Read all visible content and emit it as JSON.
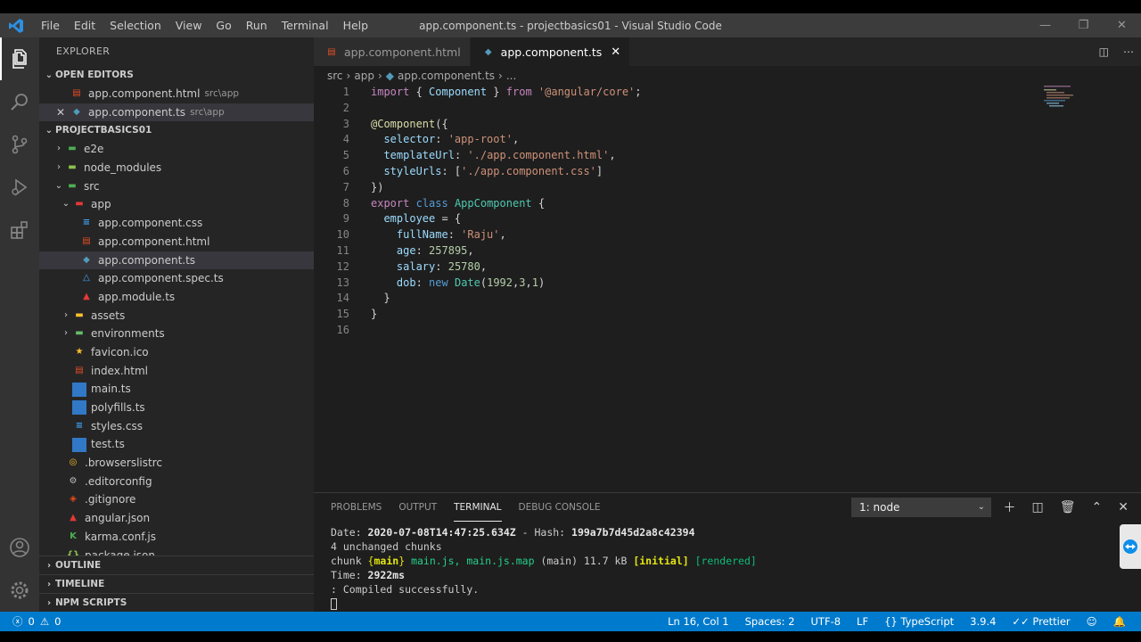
{
  "window": {
    "title": "app.component.ts - projectbasics01 - Visual Studio Code",
    "menu": [
      "File",
      "Edit",
      "Selection",
      "View",
      "Go",
      "Run",
      "Terminal",
      "Help"
    ],
    "controls": {
      "minimize": "—",
      "restore": "❐",
      "close": "✕"
    }
  },
  "sidebar": {
    "title": "EXPLORER",
    "open_editors": {
      "header": "OPEN EDITORS",
      "items": [
        {
          "name": "app.component.html",
          "path": "src\\app"
        },
        {
          "name": "app.component.ts",
          "path": "src\\app"
        }
      ]
    },
    "project": {
      "header": "PROJECTBASICS01",
      "tree": [
        {
          "label": "e2e",
          "chev": "›"
        },
        {
          "label": "node_modules",
          "chev": "›"
        },
        {
          "label": "src",
          "chev": "⌄"
        },
        {
          "label": "app",
          "chev": "⌄"
        },
        {
          "label": "app.component.css"
        },
        {
          "label": "app.component.html"
        },
        {
          "label": "app.component.ts"
        },
        {
          "label": "app.component.spec.ts"
        },
        {
          "label": "app.module.ts"
        },
        {
          "label": "assets",
          "chev": "›"
        },
        {
          "label": "environments",
          "chev": "›"
        },
        {
          "label": "favicon.ico"
        },
        {
          "label": "index.html"
        },
        {
          "label": "main.ts"
        },
        {
          "label": "polyfills.ts"
        },
        {
          "label": "styles.css"
        },
        {
          "label": "test.ts"
        },
        {
          "label": ".browserslistrc"
        },
        {
          "label": ".editorconfig"
        },
        {
          "label": ".gitignore"
        },
        {
          "label": "angular.json"
        },
        {
          "label": "karma.conf.js"
        },
        {
          "label": "package.json"
        }
      ]
    },
    "bottom_sections": [
      "OUTLINE",
      "TIMELINE",
      "NPM SCRIPTS"
    ]
  },
  "editor": {
    "tabs": [
      {
        "label": "app.component.html"
      },
      {
        "label": "app.component.ts",
        "close": "✕"
      }
    ],
    "breadcrumb": [
      "src",
      "app",
      "app.component.ts",
      "..."
    ],
    "line_numbers": [
      "1",
      "2",
      "3",
      "4",
      "5",
      "6",
      "7",
      "8",
      "9",
      "10",
      "11",
      "12",
      "13",
      "14",
      "15",
      "16"
    ]
  },
  "panel": {
    "tabs": [
      "PROBLEMS",
      "OUTPUT",
      "TERMINAL",
      "DEBUG CONSOLE"
    ],
    "terminal_select": "1: node",
    "terminal": {
      "date_label": "Date: ",
      "date_value": "2020-07-08T14:47:25.634Z",
      "hash_label": " - Hash: ",
      "hash_value": "199a7b7d45d2a8c42394",
      "line2": "4 unchanged chunks",
      "chunk_label": "chunk ",
      "chunk_name": "{main}",
      "chunk_files": "main.js, main.js.map",
      "chunk_rest": " (main) 11.7 kB ",
      "chunk_initial": "[initial]",
      "chunk_rendered": "[rendered]",
      "time_label": "Time: ",
      "time_value": "2922ms",
      "compiled": ": Compiled successfully."
    }
  },
  "statusbar": {
    "errors": "0",
    "warnings": "0",
    "position": "Ln 16, Col 1",
    "spaces": "Spaces: 2",
    "encoding": "UTF-8",
    "eol": "LF",
    "language": "TypeScript",
    "version": "3.9.4",
    "formatter": "Prettier"
  }
}
